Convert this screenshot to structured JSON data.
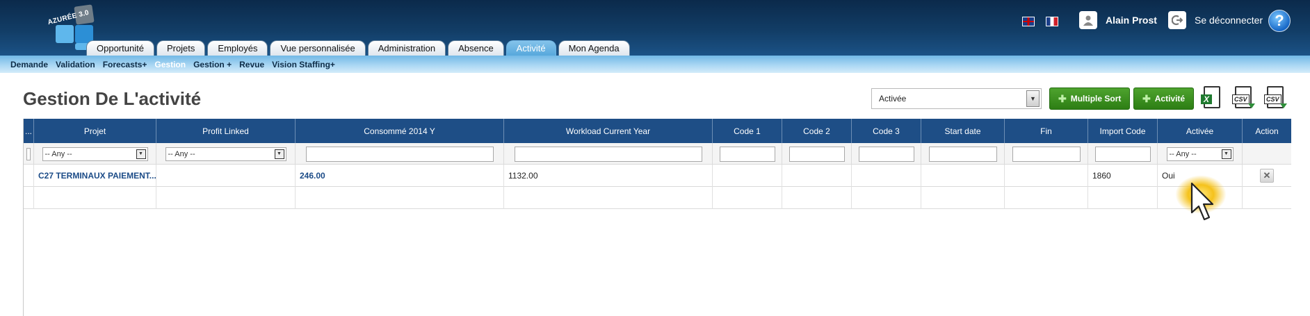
{
  "app": {
    "logo_text": "AZURÉE 3.0",
    "user_name": "Alain Prost",
    "logout_label": "Se déconnecter",
    "help_glyph": "?"
  },
  "colors": {
    "header_dark": "#0b2a4b",
    "grid_header": "#1e4e86",
    "active_tab": "#57a8dc",
    "button_green": "#2d7e14",
    "link_blue": "#1b4b87"
  },
  "icons": {
    "language_en": "uk-flag-icon",
    "language_fr": "france-flag-icon",
    "user": "user-icon",
    "logout": "logout-icon",
    "help": "help-icon",
    "export_excel": "excel-export-icon",
    "export_csv": "csv-export-icon",
    "delete": "close-icon"
  },
  "tabs": [
    {
      "label": "Opportunité"
    },
    {
      "label": "Projets"
    },
    {
      "label": "Employés"
    },
    {
      "label": "Vue personnalisée"
    },
    {
      "label": "Administration"
    },
    {
      "label": "Absence"
    },
    {
      "label": "Activité",
      "active": true
    },
    {
      "label": "Mon Agenda"
    }
  ],
  "subnav": [
    {
      "label": "Demande"
    },
    {
      "label": "Validation"
    },
    {
      "label": "Forecasts+"
    },
    {
      "label": "Gestion",
      "active": true
    },
    {
      "label": "Gestion +"
    },
    {
      "label": "Revue"
    },
    {
      "label": "Vision Staffing+"
    }
  ],
  "page": {
    "title": "Gestion De L'activité",
    "status_filter": "Activée",
    "multiple_sort_label": "Multiple Sort",
    "add_activity_label": "Activité",
    "csv_label": "CSV",
    "excel_label": "X"
  },
  "grid": {
    "columns": [
      "Projet",
      "Profit Linked",
      "Consommé 2014 Y",
      "Workload Current Year",
      "Code 1",
      "Code 2",
      "Code 3",
      "Start date",
      "Fin",
      "Import Code",
      "Activée",
      "Action"
    ],
    "first_col_header": "...",
    "filters": {
      "projet": "-- Any --",
      "profit_linked": "-- Any --",
      "activee": "-- Any --"
    },
    "rows": [
      {
        "projet": "C27 TERMINAUX PAIEMENT...",
        "profit_linked": "",
        "consomme": "246.00",
        "workload": "1132.00",
        "code1": "",
        "code2": "",
        "code3": "",
        "start_date": "",
        "fin": "",
        "import_code": "1860",
        "activee": "Oui"
      }
    ]
  }
}
